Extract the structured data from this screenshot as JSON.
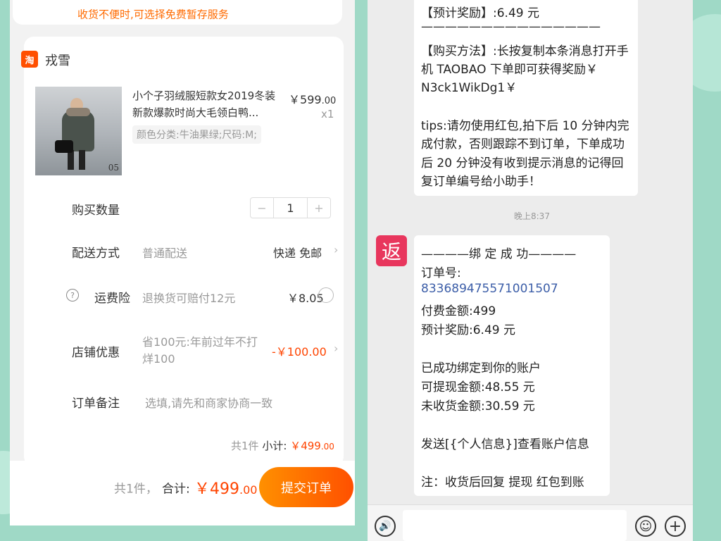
{
  "left": {
    "notice": "收货不便时,可选择免费暂存服务",
    "shop": {
      "logo": "淘",
      "name": "戎雪"
    },
    "product": {
      "title": "小个子羽绒服短款女2019冬装新款爆款时尚大毛领白鸭...",
      "price_symbol": "￥",
      "price_int": "599",
      "price_dec": ".00",
      "qty": "x1",
      "spec": "颜色分类:牛油果绿;尺码:M;",
      "img_tag": "05"
    },
    "quantity": {
      "label": "购买数量",
      "minus": "−",
      "value": "1",
      "plus": "+"
    },
    "delivery": {
      "label": "配送方式",
      "value": "普通配送",
      "right": "快递 免邮"
    },
    "insurance": {
      "label": "运费险",
      "value": "退换货可赔付12元",
      "price": "￥8.05"
    },
    "discount": {
      "label": "店铺优惠",
      "value": "省100元:年前过年不打烊100",
      "amount": "-￥100.00"
    },
    "remark": {
      "label": "订单备注",
      "placeholder": "选填,请先和商家协商一致"
    },
    "subtotal": {
      "count": "共1件",
      "label": "小计:",
      "symbol": "￥",
      "int": "499",
      "dec": ".00"
    },
    "bottom": {
      "count": "共1件，",
      "label": "合计:",
      "symbol": "￥",
      "int": "499",
      "dec": ".00",
      "submit": "提交订单"
    }
  },
  "right": {
    "bubble1": [
      "【预计奖励】:6.49 元",
      "———————————————",
      "【购买方法】:长按复制本条消息打开手",
      "机 TAOBAO 下单即可获得奖励￥",
      "N3ck1WikDg1￥",
      "",
      "tips:请勿使用红包,拍下后 10 分钟内完",
      "成付款，否则跟踪不到订单，下单成功",
      "后 20 分钟没有收到提示消息的记得回",
      "复订单编号给小助手！"
    ],
    "timestamp": "晚上8:37",
    "avatar_char": "返",
    "bubble2": {
      "title": "————绑 定 成 功————",
      "order_label": "订单号:",
      "order_no": "833689475571001507",
      "pay": "付费金额:499",
      "reward": "预计奖励:6.49 元",
      "bound": "已成功绑定到你的账户",
      "withdraw": "可提现金额:48.55 元",
      "pending": "未收货金额:30.59 元",
      "send": "发送[{个人信息}]查看账户信息",
      "note": "注：收货后回复   提现   红包到账"
    },
    "input": {
      "voice": "🔊",
      "emoji": "☺",
      "plus": "+"
    }
  }
}
